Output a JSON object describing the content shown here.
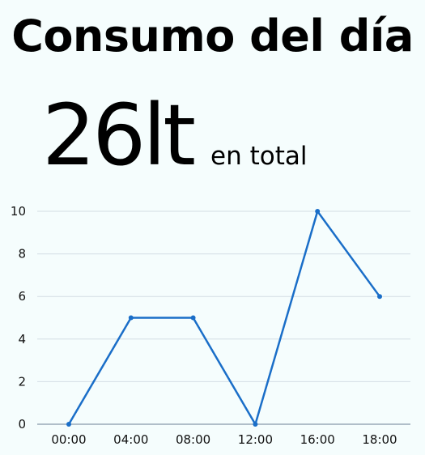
{
  "header": {
    "title": "Consumo del día",
    "total_value": "26lt",
    "total_suffix": "en total"
  },
  "chart_data": {
    "type": "line",
    "categories": [
      "00:00",
      "04:00",
      "08:00",
      "12:00",
      "16:00",
      "18:00"
    ],
    "series": [
      {
        "values": [
          0,
          5,
          5,
          0,
          10,
          6
        ]
      }
    ],
    "ylim": [
      0,
      10
    ],
    "yticks": [
      0,
      2,
      4,
      6,
      8,
      10
    ],
    "grid": true,
    "line_color": "#1a6ec8",
    "grid_color": "#d4dde4",
    "axis_color": "#8899aa"
  }
}
